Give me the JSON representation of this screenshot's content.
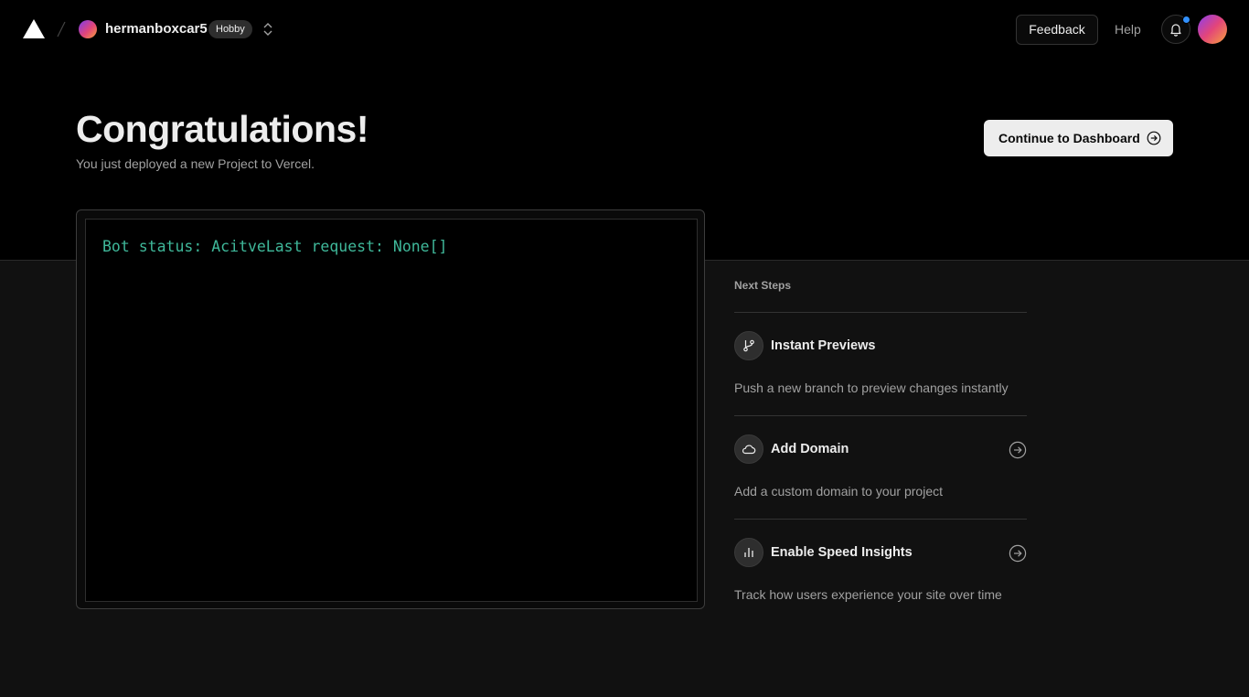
{
  "header": {
    "team_name": "hermanboxcar5",
    "plan_badge": "Hobby",
    "feedback_label": "Feedback",
    "help_label": "Help"
  },
  "hero": {
    "title": "Congratulations!",
    "subtitle": "You just deployed a new Project to Vercel.",
    "continue_label": "Continue to Dashboard"
  },
  "preview": {
    "text": "Bot status: AcitveLast request: None[]"
  },
  "next_steps": {
    "heading": "Next Steps",
    "items": [
      {
        "title": "Instant Previews",
        "description": "Push a new branch to preview changes instantly",
        "icon": "git-branch-icon",
        "has_arrow": false
      },
      {
        "title": "Add Domain",
        "description": "Add a custom domain to your project",
        "icon": "cloud-icon",
        "has_arrow": true
      },
      {
        "title": "Enable Speed Insights",
        "description": "Track how users experience your site over time",
        "icon": "bar-chart-icon",
        "has_arrow": true
      }
    ]
  },
  "colors": {
    "background_top": "#000000",
    "background_bottom": "#111111",
    "preview_text": "#3fb89a",
    "notification_dot": "#3291ff"
  }
}
